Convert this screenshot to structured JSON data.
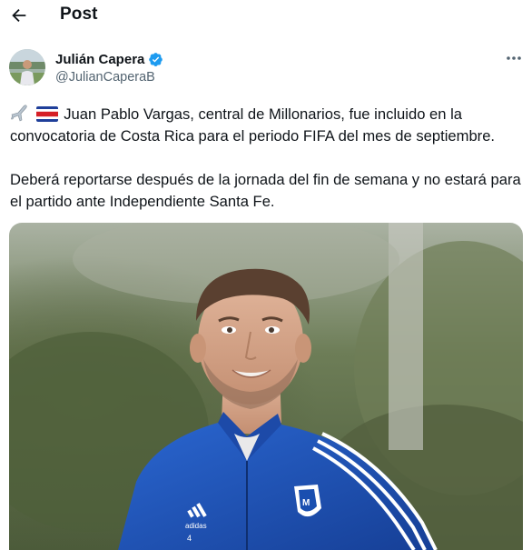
{
  "header": {
    "title": "Post",
    "back_icon": "arrow-left-icon"
  },
  "author": {
    "name": "Julián Capera",
    "handle": "@JulianCaperaB",
    "verified_icon": "verified-badge-icon",
    "verified_color": "#1d9bf0"
  },
  "more_icon": "more-horizontal-icon",
  "post": {
    "emoji": [
      "airplane-emoji",
      "costa-rica-flag-emoji"
    ],
    "paragraph1": "Juan Pablo Vargas, central de Millonarios, fue incluido en la convocatoria de Costa Rica para el periodo FIFA del mes de septiembre.",
    "paragraph2": "Deberá reportarse después de la jornada del fin de semana y no estará para el partido ante Independiente Santa Fe."
  },
  "media": {
    "kind": "photo",
    "jersey_number": "4",
    "colors": {
      "jersey": "#1a4fb0",
      "trim": "#ffffff",
      "background": "#5a6a42"
    }
  }
}
